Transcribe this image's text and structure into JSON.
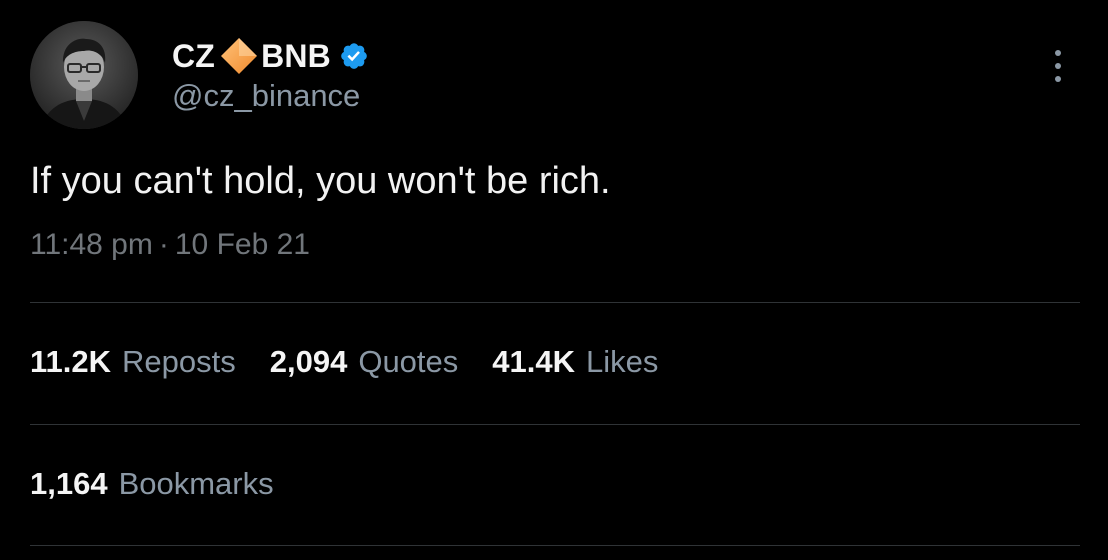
{
  "author": {
    "name_first": "CZ",
    "name_second": "BNB",
    "handle": "@cz_binance",
    "avatar_icon": "avatar-photo",
    "name_emoji_icon": "orange-diamond-icon",
    "verified_icon": "verified-badge-icon",
    "verified_color": "#1d9bf0",
    "diamond_color": "#f7a14a"
  },
  "tweet": {
    "text": "If you can't hold, you won't be rich.",
    "time": "11:48 pm",
    "separator": "·",
    "date": "10 Feb 21"
  },
  "stats": {
    "reposts": {
      "value": "11.2K",
      "label": "Reposts"
    },
    "quotes": {
      "value": "2,094",
      "label": "Quotes"
    },
    "likes": {
      "value": "41.4K",
      "label": "Likes"
    },
    "bookmarks": {
      "value": "1,164",
      "label": "Bookmarks"
    }
  },
  "menu": {
    "icon": "more-vertical-icon"
  }
}
